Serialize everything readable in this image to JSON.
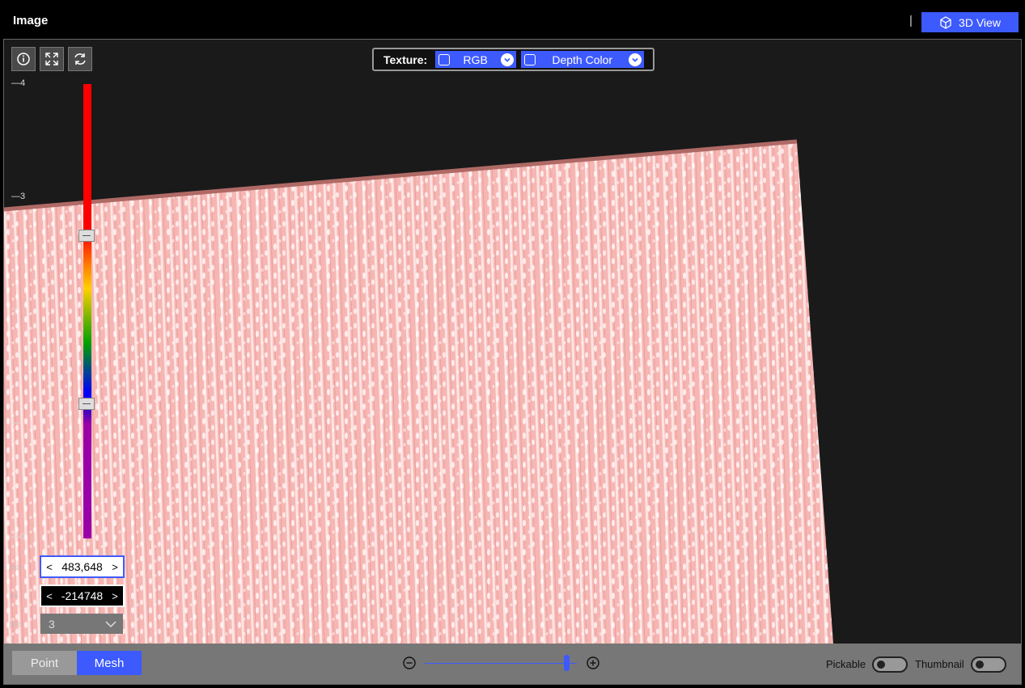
{
  "header": {
    "title": "Image",
    "separator": "|",
    "view_button_label": "3D View"
  },
  "toolbar": {
    "info_icon": "info-icon",
    "fullscreen_icon": "expand-icon",
    "reset_icon": "refresh-icon"
  },
  "texture": {
    "label": "Texture:",
    "options": [
      {
        "label": "RGB",
        "checked": false
      },
      {
        "label": "Depth Color",
        "checked": false
      }
    ]
  },
  "color_scale": {
    "tick_labels": [
      "4",
      "3",
      "",
      "",
      "0"
    ],
    "side_tags": [
      "ma",
      "mi",
      "pre"
    ]
  },
  "range": {
    "max_value": "483,648",
    "min_value": "-214748",
    "precision": "3"
  },
  "bottom": {
    "modes": [
      "Point",
      "Mesh"
    ],
    "active_mode": "Mesh",
    "zoom_level": 0.92,
    "pickable_label": "Pickable",
    "pickable_on": false,
    "thumbnail_label": "Thumbnail",
    "thumbnail_on": false
  },
  "colors": {
    "accent": "#3d5afe",
    "mesh": "#f6b6b3",
    "background": "#1a1a1a"
  }
}
